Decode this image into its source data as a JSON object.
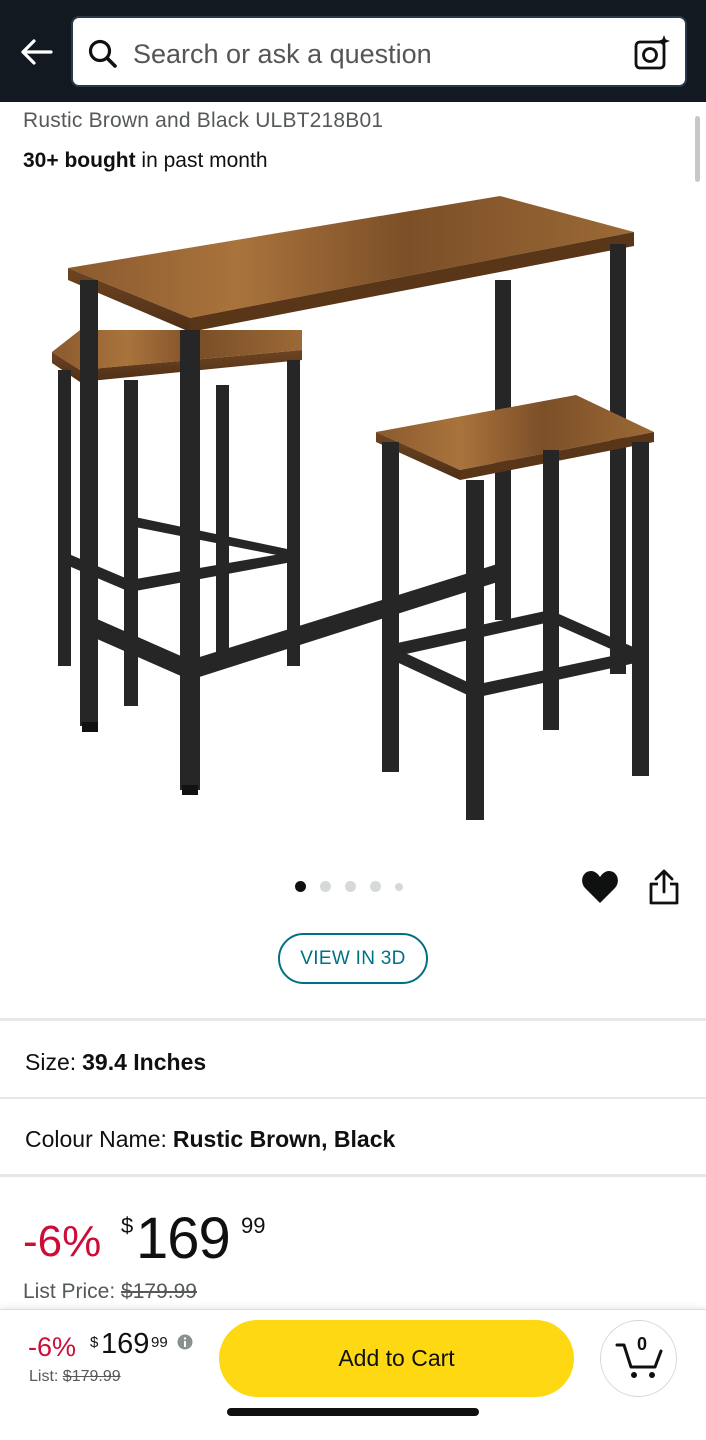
{
  "header": {
    "search_placeholder": "Search or ask a question"
  },
  "product": {
    "title_visible": "Rustic Brown and Black ULBT218B01",
    "bought_bold": "30+ bought",
    "bought_rest": " in past month",
    "image_icon": "bar-table-set-image",
    "gallery_dot_count": 5,
    "gallery_active_index": 0,
    "view_3d_label": "VIEW IN 3D"
  },
  "options": {
    "size_label": "Size:",
    "size_value": "39.4 Inches",
    "colour_label": "Colour Name:",
    "colour_value": "Rustic Brown, Black"
  },
  "price": {
    "discount": "-6%",
    "currency": "$",
    "whole": "169",
    "fraction": "99",
    "list_label": "List Price:",
    "list_value": "$179.99"
  },
  "bottom_bar": {
    "discount": "-6%",
    "currency": "$",
    "whole": "169",
    "fraction": "99",
    "list_label": "List:",
    "list_value": "$179.99",
    "add_to_cart": "Add to Cart",
    "cart_count": "0"
  },
  "colors": {
    "header_bg": "#131921",
    "deal_red": "#CC0C39",
    "link_teal": "#007185",
    "cart_yellow": "#FFD814"
  }
}
